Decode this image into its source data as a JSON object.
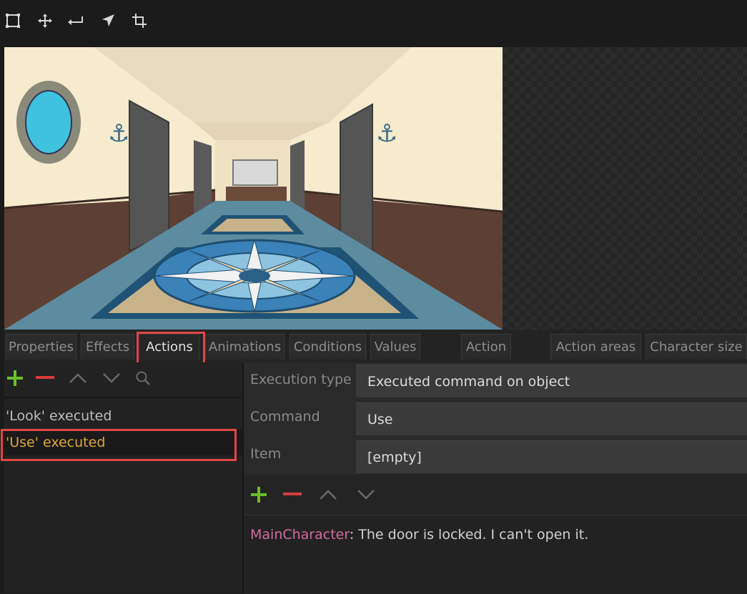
{
  "toolbar": {
    "tools": [
      {
        "icon": "select-rect-icon"
      },
      {
        "icon": "move-icon"
      },
      {
        "icon": "return-icon"
      },
      {
        "icon": "pointer-icon"
      },
      {
        "icon": "crop-icon"
      }
    ]
  },
  "tabs": [
    {
      "label": "Properties"
    },
    {
      "label": "Effects"
    },
    {
      "label": "Actions",
      "active": true
    },
    {
      "label": "Animations"
    },
    {
      "label": "Conditions"
    },
    {
      "label": "Values"
    },
    {
      "label": "Action"
    },
    {
      "label": "Action areas"
    },
    {
      "label": "Character size"
    }
  ],
  "actions_list": {
    "items": [
      {
        "label": "'Look' executed"
      },
      {
        "label": "'Use' executed",
        "selected": true
      }
    ]
  },
  "action_props": {
    "execution_type_label": "Execution type",
    "execution_type_value": "Executed command on object",
    "command_label": "Command",
    "command_value": "Use",
    "item_label": "Item",
    "item_value": "[empty]"
  },
  "dialogue": {
    "speaker": "MainCharacter",
    "separator": ": ",
    "text": "The door is locked. I can't open it."
  },
  "colors": {
    "add": "#6bbf2a",
    "remove": "#d83a3a",
    "highlight": "#e04646",
    "speaker": "#d36a9c",
    "selected_text": "#e0a536"
  }
}
